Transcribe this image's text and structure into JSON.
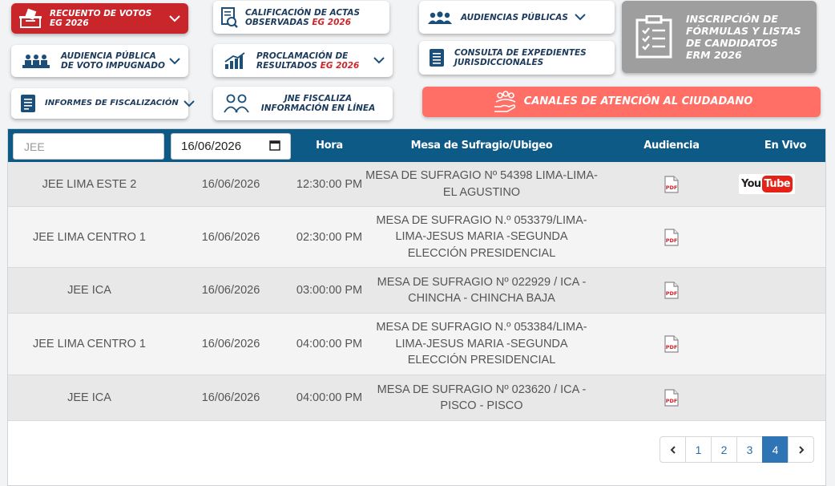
{
  "nav": {
    "recuento": {
      "line1": "RECUENTO DE VOTOS",
      "line2": "EG 2026"
    },
    "calificacion": {
      "line1": "CALIFICACIÓN DE ACTAS",
      "line2a": "OBSERVADAS",
      "line2b": "EG 2026"
    },
    "audiencias": {
      "label": "AUDIENCIAS PÚBLICAS"
    },
    "inscripcion": {
      "line1": "INSCRIPCIÓN DE",
      "line2": "FÓRMULAS Y LISTAS",
      "line3": "DE CANDIDATOS",
      "line4": "ERM 2026"
    },
    "audiencia_impugnado": {
      "line1": "AUDIENCIA PÚBLICA",
      "line2": "DE VOTO IMPUGNADO"
    },
    "proclamacion": {
      "line1": "PROCLAMACIÓN DE",
      "line2a": "RESULTADOS",
      "line2b": "EG 2026"
    },
    "consulta": {
      "line1": "CONSULTA DE EXPEDIENTES",
      "line2": "JURISDICCIONALES"
    },
    "informes": {
      "label": "INFORMES DE FISCALIZACIÓN"
    },
    "jne": {
      "line1": "JNE FISCALIZA",
      "line2": "INFORMACIÓN EN LÍNEA"
    },
    "canales": {
      "label": "CANALES DE ATENCIÓN AL CIUDADANO"
    }
  },
  "table": {
    "filter_jee_placeholder": "JEE",
    "filter_date": "16/06/2026",
    "headers": {
      "hora": "Hora",
      "mesa": "Mesa de Sufragio/Ubigeo",
      "audiencia": "Audiencia",
      "envivo": "En Vivo"
    },
    "rows": [
      {
        "jee": "JEE LIMA ESTE 2",
        "fecha": "16/06/2026",
        "hora": "12:30:00 PM",
        "mesa": "MESA DE SUFRAGIO Nº 54398 LIMA-LIMA-EL AGUSTINO",
        "audiencia": "pdf-icon",
        "envivo": "youtube-logo"
      },
      {
        "jee": "JEE LIMA CENTRO 1",
        "fecha": "16/06/2026",
        "hora": "02:30:00 PM",
        "mesa": "MESA DE SUFRAGIO N.º 053379/LIMA-LIMA-JESUS MARIA -SEGUNDA ELECCIÓN PRESIDENCIAL",
        "audiencia": "pdf-icon"
      },
      {
        "jee": "JEE ICA",
        "fecha": "16/06/2026",
        "hora": "03:00:00 PM",
        "mesa": "MESA DE SUFRAGIO Nº 022929 / ICA - CHINCHA - CHINCHA BAJA",
        "audiencia": "pdf-icon"
      },
      {
        "jee": "JEE LIMA CENTRO 1",
        "fecha": "16/06/2026",
        "hora": "04:00:00 PM",
        "mesa": "MESA DE SUFRAGIO N.º 053384/LIMA-LIMA-JESUS MARIA -SEGUNDA ELECCIÓN PRESIDENCIAL",
        "audiencia": "pdf-icon"
      },
      {
        "jee": "JEE ICA",
        "fecha": "16/06/2026",
        "hora": "04:00:00 PM",
        "mesa": "MESA DE SUFRAGIO Nº 023620 / ICA - PISCO - PISCO",
        "audiencia": "pdf-icon"
      }
    ]
  },
  "pagination": {
    "pages": [
      "1",
      "2",
      "3",
      "4"
    ],
    "active": "4",
    "prev_icon": "chevron-left-icon",
    "next_icon": "chevron-right-icon"
  },
  "youtube": {
    "you": "You",
    "tube": "Tube"
  },
  "pdf_label": "PDF",
  "colors": {
    "brand_red": "#c9262c",
    "header_blue": "#0e5a87",
    "salmon": "#ff6f66",
    "gray_btn": "#9e9e9e",
    "active_page": "#2f75b5"
  }
}
